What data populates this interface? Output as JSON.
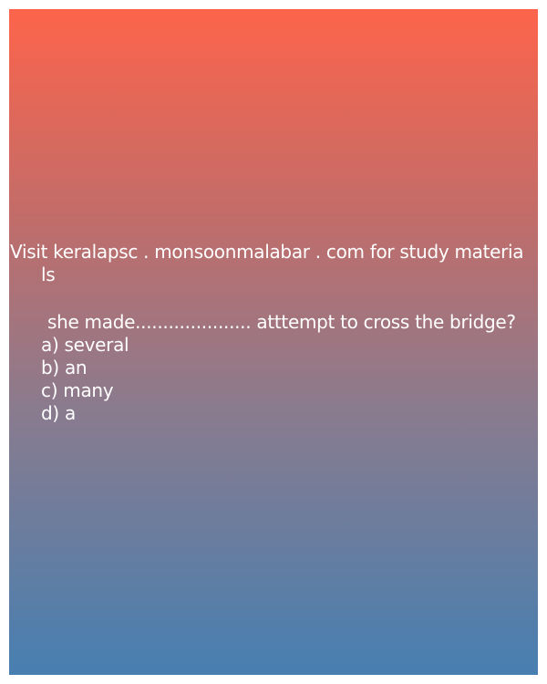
{
  "source_line_1": "Visit keralapsc . monsoonmalabar . com for study materia",
  "source_line_2": "ls",
  "question": "she made..................... atttempt to cross the bridge?",
  "options": [
    "a) several",
    "b) an",
    "c) many",
    "d) a"
  ],
  "colors": {
    "gradient_top": "#fd644b",
    "gradient_bottom": "#477fb1",
    "text": "#ffffff"
  }
}
